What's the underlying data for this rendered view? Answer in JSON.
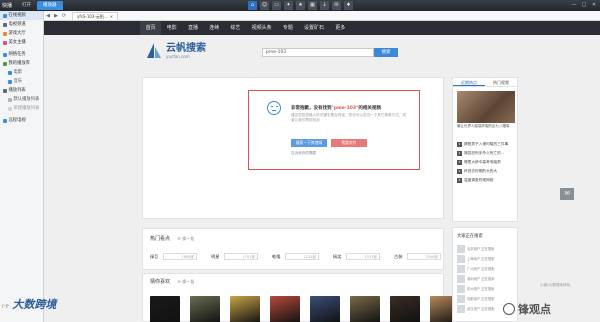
{
  "titlebar": {
    "app_name": "快播",
    "tabs": [
      "打开",
      "播放器"
    ],
    "window_controls": [
      "—",
      "□",
      "✕"
    ]
  },
  "sidebar": {
    "items": [
      {
        "label": "在线视频",
        "type": "head"
      },
      {
        "label": "电视频道",
        "type": "head"
      },
      {
        "label": "游戏大厅",
        "type": "head"
      },
      {
        "label": "美女主播",
        "type": "head"
      },
      {
        "label": "网络任务",
        "type": "head"
      },
      {
        "label": "我的播放库",
        "type": "head"
      },
      {
        "label": "电影",
        "type": "sub"
      },
      {
        "label": "音乐",
        "type": "sub"
      },
      {
        "label": "播放列表",
        "type": "head"
      },
      {
        "label": "默认播放列表",
        "type": "sub"
      },
      {
        "label": "新建播放列表",
        "type": "sub-muted"
      },
      {
        "label": "远程电视",
        "type": "head"
      }
    ]
  },
  "navbar": {
    "tab_title": "yfsS-103-云帆...",
    "nav_buttons": [
      "◀",
      "▶",
      "⟳"
    ]
  },
  "mainnav": {
    "items": [
      "首页",
      "电影",
      "直播",
      "连续",
      "综艺",
      "视频头条",
      "专题",
      "设置矿石",
      "更多"
    ]
  },
  "site": {
    "logo_cn": "云帆搜索",
    "logo_en": "yunfan.com",
    "search_value": "pme-103",
    "search_button": "搜索"
  },
  "notfound": {
    "title_prefix": "非常抱歉，没有找到",
    "keyword": "\"pme-103\"",
    "title_suffix": "的相关视频",
    "description": "建议您检查输入的关键字是否有误，您也可以尝试一下其它搜索方式，或者让我们帮您找到",
    "button_primary": "搜索一下其他网",
    "button_secondary": "我要求片",
    "link": "告诉我你的需要"
  },
  "hot_search": {
    "title": "热门看点",
    "swap": "换一批",
    "items": [
      {
        "name": "绿巨",
        "count": "1888部"
      },
      {
        "name": "明星",
        "count": "1751部"
      },
      {
        "name": "乾隆",
        "count": "1219部"
      },
      {
        "name": "搞笑",
        "count": "1513部"
      },
      {
        "name": "古装",
        "count": "2548部"
      }
    ]
  },
  "guess": {
    "title": "猜你喜欢",
    "swap": "换一批",
    "posters": [
      {
        "name": "poster-leon",
        "color": "#1a1a1a"
      },
      {
        "name": "poster-2",
        "color": "#6a6c52"
      },
      {
        "name": "poster-3",
        "color": "#c8a547"
      },
      {
        "name": "poster-4",
        "color": "#b64a3c"
      },
      {
        "name": "poster-5",
        "color": "#3c4e78"
      },
      {
        "name": "poster-6",
        "color": "#7a6a4a"
      },
      {
        "name": "poster-7",
        "color": "#3a2c25"
      },
      {
        "name": "poster-8",
        "color": "#b88a5a"
      }
    ]
  },
  "right_panel": {
    "tabs": [
      "近期热点",
      "热门视频"
    ],
    "caption": "最让世界人脑袋炸裂的乱七八糟事",
    "list": [
      "搞怪男子入侵时髦的三件事",
      "搞囚犯刑手杀人死亡的...",
      "哪里大龄中高考电脑男",
      "杯逃去时期的大的大",
      "温度调查时候网络"
    ]
  },
  "right_panel2": {
    "title": "大家正在搜索",
    "items": [
      "北京用户 正在搜索",
      "上海用户 正在搜索",
      "广州用户 正在搜索",
      "深圳用户 正在搜索",
      "杭州用户 正在搜索",
      "成都用户 正在搜索",
      "武汉用户 正在搜索"
    ]
  },
  "footer": {
    "left_brand": "大数跨境",
    "status_right": "小编QQ群搜索体验",
    "watermark": "锋观点"
  }
}
